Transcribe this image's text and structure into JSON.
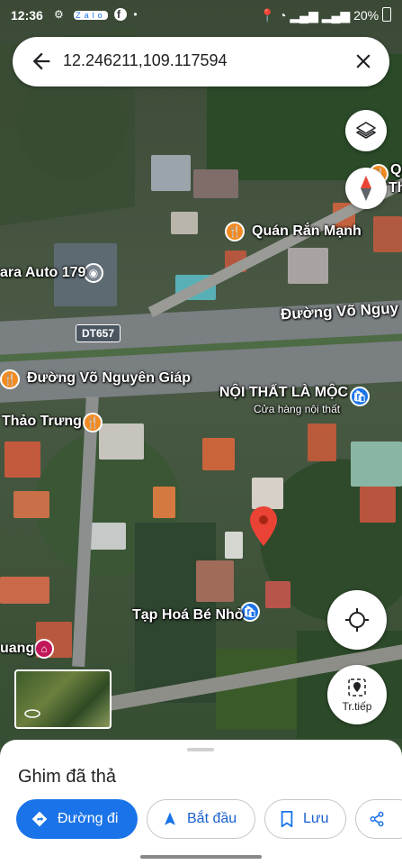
{
  "status_bar": {
    "time": "12:36",
    "app_icons": [
      "gear-icon",
      "zalo-icon",
      "facebook-icon",
      "dot-icon"
    ],
    "battery": "20%"
  },
  "search": {
    "query": "12.246211,109.117594"
  },
  "map_labels": {
    "road_main_right": "Đường Võ Nguy",
    "road_main_left": "Đường Võ Nguyên Giáp",
    "road_shield": "DT657",
    "poi_quan_ran": "Quán Rắn Mạnh",
    "poi_gara": "ara Auto 179",
    "poi_noi_that": "NỘI THẤT LÀ MỘC",
    "poi_noi_that_sub": "Cửa hàng nội thất",
    "poi_thao_trung": "Thảo Trưng",
    "poi_tap_hoa": "Tạp Hoá Bé Nhỏ",
    "poi_q_partial": "Q",
    "poi_th_partial": "Th",
    "poi_uang_partial": "uang"
  },
  "controls": {
    "layers_icon": "layers-icon",
    "compass_icon": "compass-icon",
    "location_icon": "my-location-icon",
    "next_label": "Tr.tiếp"
  },
  "sheet": {
    "title": "Ghim đã thả",
    "directions_label": "Đường đi",
    "start_label": "Bắt đầu",
    "save_label": "Lưu"
  },
  "colors": {
    "accent": "#1a73e8",
    "pin": "#ea4335",
    "food_poi": "#f28b22",
    "shop_poi": "#1a73e8"
  }
}
